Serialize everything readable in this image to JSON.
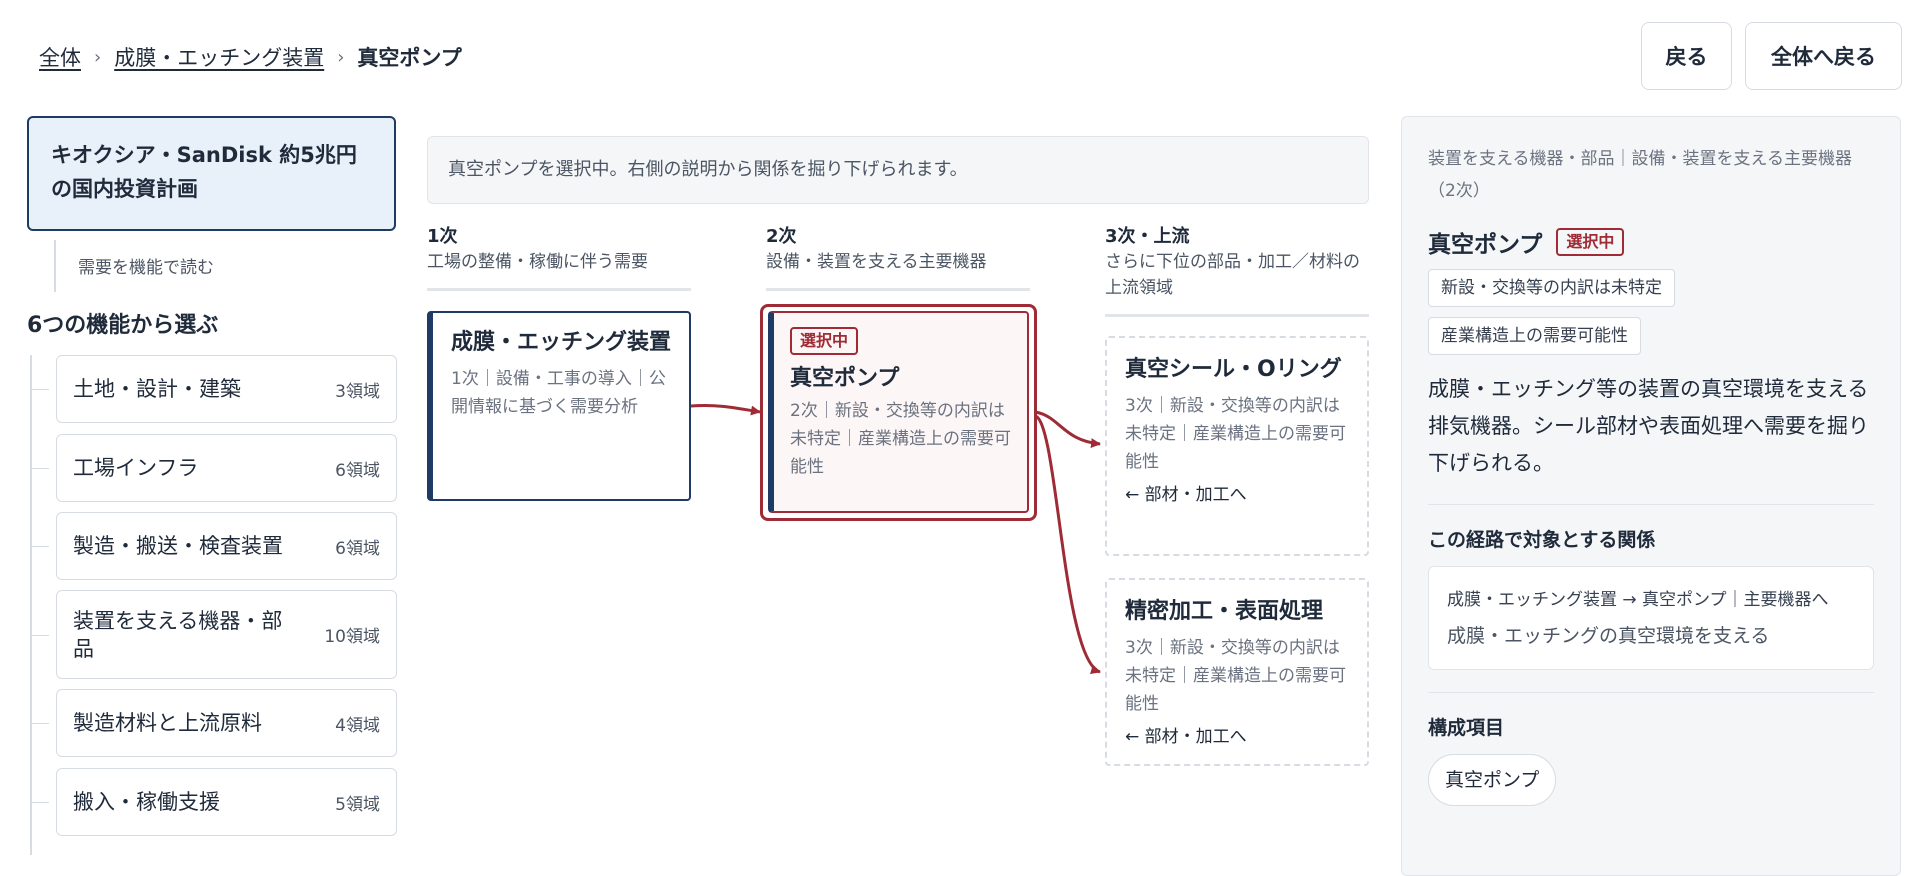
{
  "breadcrumb": {
    "root": "全体",
    "parent": "成膜・エッチング装置",
    "current": "真空ポンプ",
    "separator": "›"
  },
  "buttons": {
    "back": "戻る",
    "to_top": "全体へ戻る"
  },
  "sidebar": {
    "project_title": "キオクシア・SanDisk 約5兆円の国内投資計画",
    "sub_item": "需要を機能で読む",
    "section_heading": "6つの機能から選ぶ",
    "functions": [
      {
        "label": "土地・設計・建築",
        "count": "3領域"
      },
      {
        "label": "工場インフラ",
        "count": "6領域"
      },
      {
        "label": "製造・搬送・検査装置",
        "count": "6領域"
      },
      {
        "label": "装置を支える機器・部品",
        "count": "10領域"
      },
      {
        "label": "製造材料と上流原料",
        "count": "4領域"
      },
      {
        "label": "搬入・稼働支援",
        "count": "5領域"
      }
    ]
  },
  "main": {
    "info": "真空ポンプを選択中。右側の説明から関係を掘り下げられます。",
    "columns": [
      {
        "title": "1次",
        "desc": "工場の整備・稼働に伴う需要"
      },
      {
        "title": "2次",
        "desc": "設備・装置を支える主要機器"
      },
      {
        "title": "3次・上流",
        "desc": "さらに下位の部品・加工／材料の上流領域"
      }
    ],
    "nodes": {
      "l1": {
        "title": "成膜・エッチング装置",
        "desc": "1次｜設備・工事の導入｜公開情報に基づく需要分析"
      },
      "l2": {
        "badge": "選択中",
        "title": "真空ポンプ",
        "desc": "2次｜新設・交換等の内訳は未特定｜産業構造上の需要可能性"
      },
      "l3a": {
        "title": "真空シール・Oリング",
        "desc": "3次｜新設・交換等の内訳は未特定｜産業構造上の需要可能性",
        "link": "← 部材・加工へ"
      },
      "l3b": {
        "title": "精密加工・表面処理",
        "desc": "3次｜新設・交換等の内訳は未特定｜産業構造上の需要可能性",
        "link": "← 部材・加工へ"
      }
    }
  },
  "detail": {
    "category": "装置を支える機器・部品｜設備・装置を支える主要機器（2次）",
    "title": "真空ポンプ",
    "badge": "選択中",
    "tags": [
      "新設・交換等の内訳は未特定",
      "産業構造上の需要可能性"
    ],
    "description": "成膜・エッチング等の装置の真空環境を支える排気機器。シール部材や表面処理へ需要を掘り下げられる。",
    "relation_heading": "この経路で対象とする関係",
    "relation_path": "成膜・エッチング装置 → 真空ポンプ｜主要機器へ",
    "relation_desc": "成膜・エッチングの真空環境を支える",
    "components_heading": "構成項目",
    "components": [
      "真空ポンプ"
    ]
  },
  "colors": {
    "accent_red": "#9e2b35",
    "navy": "#1f3b63",
    "panel_bg": "#f4f6f8"
  },
  "icons": {
    "arrow": "arrow-right-icon"
  }
}
